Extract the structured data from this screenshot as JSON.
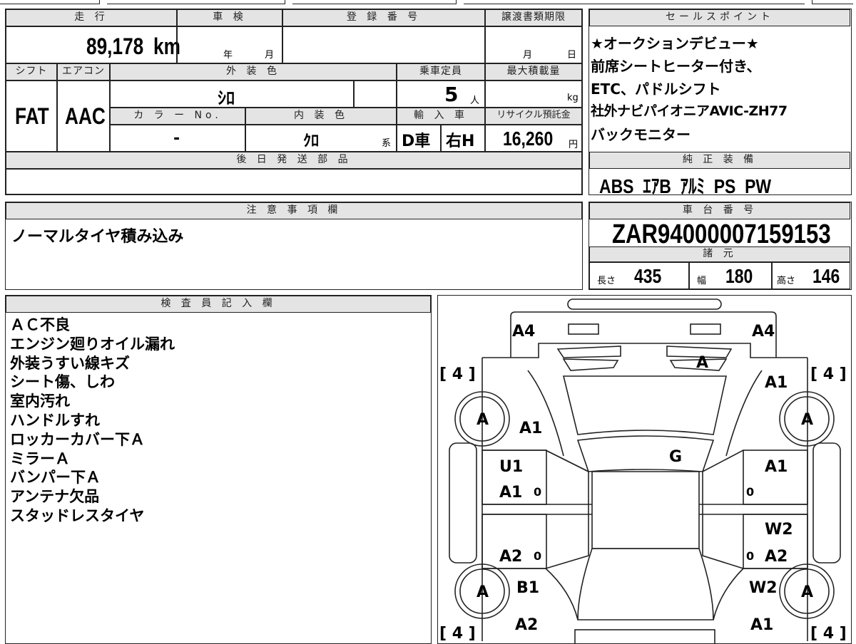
{
  "vehicle": {
    "mileage_label": "走 行",
    "mileage_value": "89,178",
    "mileage_unit": "km",
    "inspection_label": "車 検",
    "inspection_year_unit": "年",
    "inspection_month_unit": "月",
    "registration_label": "登 録 番 号",
    "transfer_deadline_label": "譲渡書類期限",
    "transfer_month_unit": "月",
    "transfer_day_unit": "日",
    "shift_label": "シフト",
    "shift_value": "FAT",
    "ac_label": "エアコン",
    "ac_value": "AAC",
    "exterior_color_label": "外 装 色",
    "exterior_color_value": "ｼﾛ",
    "capacity_label": "乗車定員",
    "capacity_value": "5",
    "capacity_unit": "人",
    "max_load_label": "最大積載量",
    "max_load_unit": "kg",
    "color_no_label": "カ ラ ー No.",
    "color_no_value": "-",
    "interior_color_label": "内 装 色",
    "interior_color_value": "ｸﾛ",
    "interior_color_suffix": "系",
    "import_label": "輸 入 車",
    "import_value": "D車",
    "steering_value": "右H",
    "recycle_label": "リサイクル預託金",
    "recycle_value": "16,260",
    "recycle_unit": "円",
    "later_parts_label": "後 日 発 送 部 品"
  },
  "sales_points": {
    "label": "セールスポイント",
    "lines": [
      "★オークションデビュー★",
      "前席シートヒーター付き、",
      "ETC、パドルシフト",
      "社外ナビパイオニアAVIC-ZH77",
      "バックモニター"
    ]
  },
  "equipment": {
    "label": "純 正 装 備",
    "value": "ABS  ｴｱB  ｱﾙﾐ  PS  PW"
  },
  "notes": {
    "label": "注 意 事 項 欄",
    "value": "ノーマルタイヤ積み込み"
  },
  "chassis": {
    "label": "車 台 番 号",
    "value": "ZAR94000007159153",
    "spec_label": "諸 元",
    "length_label": "長さ",
    "length_value": "435",
    "width_label": "幅",
    "width_value": "180",
    "height_label": "高さ",
    "height_value": "146"
  },
  "inspector": {
    "label": "検 査 員 記 入 欄",
    "lines": [
      "ＡＣ不良",
      "エンジン廻りオイル漏れ",
      "外装うすい線キズ",
      "シート傷、しわ",
      "室内汚れ",
      "ハンドルすれ",
      "ロッカーカバー下Ａ",
      "ミラーＡ",
      "バンパー下Ａ",
      "アンテナ欠品",
      "スタッドレスタイヤ"
    ]
  },
  "diagram": {
    "marks": {
      "front_left": "A4",
      "front_right": "A4",
      "hood": "A",
      "fender_fr": "A1",
      "fender_fl": "A1",
      "roof": "G",
      "door_fl": "U1",
      "door_fl2": "A1",
      "door_fr": "A1",
      "door_rr_upper": "W2",
      "door_rl": "A2",
      "door_rr": "A2",
      "quarter_l": "B1",
      "quarter_r": "W2",
      "rear_l": "A2",
      "rear_r": "A1",
      "tire_fl": "A",
      "tire_fr": "A",
      "tire_rl": "A",
      "tire_rr": "A",
      "zero_1": "0",
      "zero_2": "0",
      "zero_3": "0",
      "zero_4": "0"
    },
    "tread": {
      "fl": "[ 4 ]",
      "fr": "[ 4 ]",
      "rl": "[ 4 ]",
      "rr": "[ 4 ]"
    }
  }
}
